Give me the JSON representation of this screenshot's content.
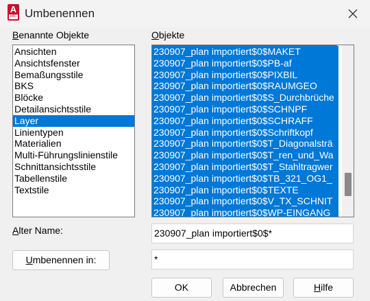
{
  "window": {
    "title": "Umbenennen",
    "icon_letter": "A",
    "icon_sub": "ABC"
  },
  "left": {
    "label_key": "B",
    "label_rest": "enannte Objekte",
    "items": [
      "Ansichten",
      "Ansichtsfenster",
      "Bemaßungsstile",
      "BKS",
      "Blöcke",
      "Detailansichtsstile",
      "Layer",
      "Linientypen",
      "Materialien",
      "Multi-Führungslinienstile",
      "Schnittansichtsstile",
      "Tabellenstile",
      "Textstile"
    ],
    "selected_item": "Layer"
  },
  "right": {
    "label_key": "O",
    "label_rest": "bjekte",
    "items": [
      "230907_plan importiert$0$MAKET",
      "230907_plan importiert$0$PB-af",
      "230907_plan importiert$0$PIXBIL",
      "230907_plan importiert$0$RAUMGEO",
      "230907_plan importiert$0$S_Durchbrüche",
      "230907_plan importiert$0$SCHNPF",
      "230907_plan importiert$0$SCHRAFF",
      "230907_plan importiert$0$Schriftkopf",
      "230907_plan importiert$0$T_Diagonalsträ",
      "230907_plan importiert$0$T_ren_und_Wa",
      "230907_plan importiert$0$T_Stahltragwer",
      "230907_plan importiert$0$TB_321_OG1_",
      "230907_plan importiert$0$TEXTE",
      "230907_plan importiert$0$V_TX_SCHNIT",
      "230907_plan importiert$0$WP-EINGANG"
    ]
  },
  "old_name": {
    "label_key": "A",
    "label_rest": "lter Name:",
    "value": "230907_plan importiert$0$*"
  },
  "rename_to": {
    "label_key": "U",
    "label_rest": "mbenennen in:",
    "value": "*"
  },
  "buttons": {
    "ok": "OK",
    "cancel": "Abbrechen",
    "help_key": "H",
    "help_rest": "ilfe"
  },
  "colors": {
    "selection": "#0078d7",
    "autocad_red": "#c8102e"
  }
}
